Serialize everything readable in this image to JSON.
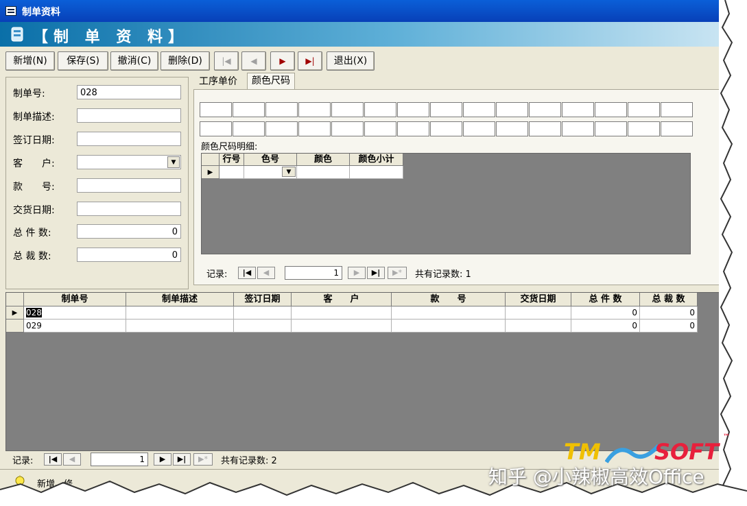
{
  "window": {
    "title": "制单资料"
  },
  "header": {
    "title": "【制 单 资 料】"
  },
  "toolbar": {
    "new": "新增(N)",
    "save": "保存(S)",
    "cancel": "撤消(C)",
    "delete": "删除(D)",
    "exit": "退出(X)"
  },
  "form": {
    "fields": [
      {
        "label": "制单号:",
        "value": "028"
      },
      {
        "label": "制单描述:",
        "value": ""
      },
      {
        "label": "签订日期:",
        "value": ""
      },
      {
        "label": "客　　户:",
        "value": ""
      },
      {
        "label": "款　　号:",
        "value": ""
      },
      {
        "label": "交货日期:",
        "value": ""
      },
      {
        "label": "总 件 数:",
        "value": "0"
      },
      {
        "label": "总 裁 数:",
        "value": "0"
      }
    ]
  },
  "tabs": [
    {
      "label": "工序单价",
      "active": false
    },
    {
      "label": "颜色尺码",
      "active": true
    }
  ],
  "color_size": {
    "detail_label": "颜色尺码明细:",
    "columns": [
      "行号",
      "色号",
      "颜色",
      "颜色小计"
    ],
    "nav": {
      "label": "记录:",
      "current": "1",
      "total_text": "共有记录数: 1"
    }
  },
  "main_grid": {
    "columns": [
      "制单号",
      "制单描述",
      "签订日期",
      "客　　户",
      "款　　号",
      "交货日期",
      "总 件 数",
      "总 裁 数"
    ],
    "rows": [
      [
        "028",
        "",
        "",
        "",
        "",
        "",
        "0",
        "0"
      ],
      [
        "029",
        "",
        "",
        "",
        "",
        "",
        "0",
        "0"
      ]
    ],
    "nav": {
      "label": "记录:",
      "current": "1",
      "total_text": "共有记录数: 2"
    }
  },
  "statusbar": {
    "text": "新增、修"
  },
  "logo": {
    "text1": "TM",
    "text2": "SOFT",
    "tm": "™"
  },
  "watermark": "知乎 @小辣椒高效Office",
  "colors": {
    "titlebar": "#0a5fd8",
    "header": "#0a6fa8",
    "grid_bg": "#808080",
    "face": "#ece9d8"
  }
}
